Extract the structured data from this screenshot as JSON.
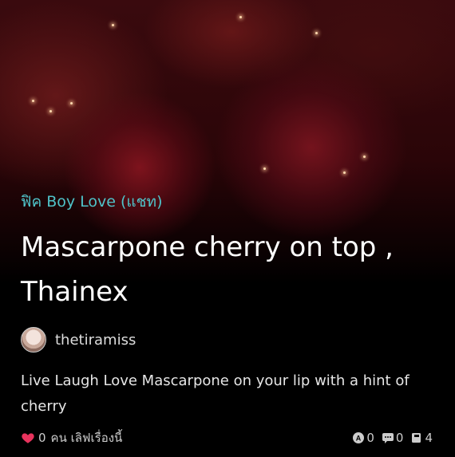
{
  "story": {
    "category": "ฟิค Boy Love (แชท)",
    "title": "Mascarpone cherry on top , Thainex",
    "author": "thetiramiss",
    "description": "Live Laugh Love Mascarpone on your lip with a hint of cherry",
    "likes_count": "0",
    "likes_label": "คน เลิฟเรื่องนี้",
    "views": "0",
    "comments": "0",
    "chapters": "4"
  },
  "colors": {
    "category": "#4fc3c9",
    "heart": "#e8335d",
    "background": "#000000"
  }
}
